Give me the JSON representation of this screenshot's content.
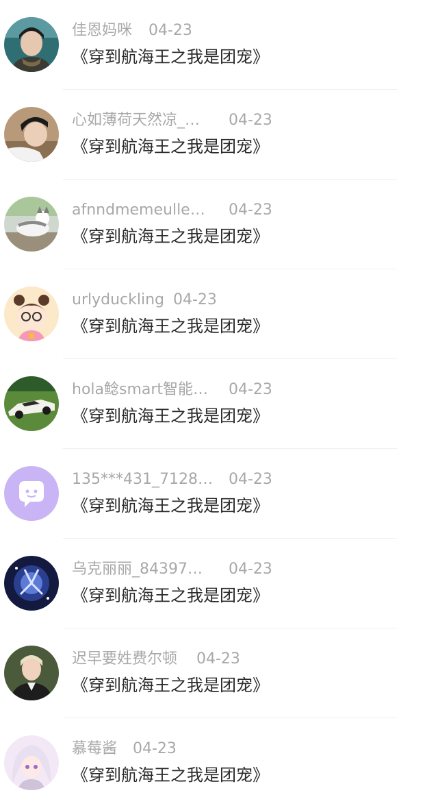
{
  "items": [
    {
      "name": "佳恩妈咪",
      "date": "04-23",
      "title": "《穿到航海王之我是团宠》",
      "avatar_icon": "woman-photo-icon"
    },
    {
      "name": "心如薄荷天然凉_…",
      "date": "04-23",
      "title": "《穿到航海王之我是团宠》",
      "avatar_icon": "young-man-photo-icon"
    },
    {
      "name": "afnndmemeulle…",
      "date": "04-23",
      "title": "《穿到航海王之我是团宠》",
      "avatar_icon": "husky-dog-photo-icon"
    },
    {
      "name": "urlyduckling",
      "date": "04-23",
      "title": "《穿到航海王之我是团宠》",
      "avatar_icon": "cartoon-girl-icon"
    },
    {
      "name": "hola鲶smart智能…",
      "date": "04-23",
      "title": "《穿到航海王之我是团宠》",
      "avatar_icon": "sports-car-photo-icon"
    },
    {
      "name": "135***431_7128…",
      "date": "04-23",
      "title": "《穿到航海王之我是团宠》",
      "avatar_icon": "chat-bubble-icon"
    },
    {
      "name": "乌克丽丽_84397…",
      "date": "04-23",
      "title": "《穿到航海王之我是团宠》",
      "avatar_icon": "galaxy-warrior-icon"
    },
    {
      "name": "迟早要姓费尔顿",
      "date": "04-23",
      "title": "《穿到航海王之我是团宠》",
      "avatar_icon": "blond-man-photo-icon"
    },
    {
      "name": "慕莓酱",
      "date": "04-23",
      "title": "《穿到航海王之我是团宠》",
      "avatar_icon": "anime-girl-icon"
    }
  ]
}
